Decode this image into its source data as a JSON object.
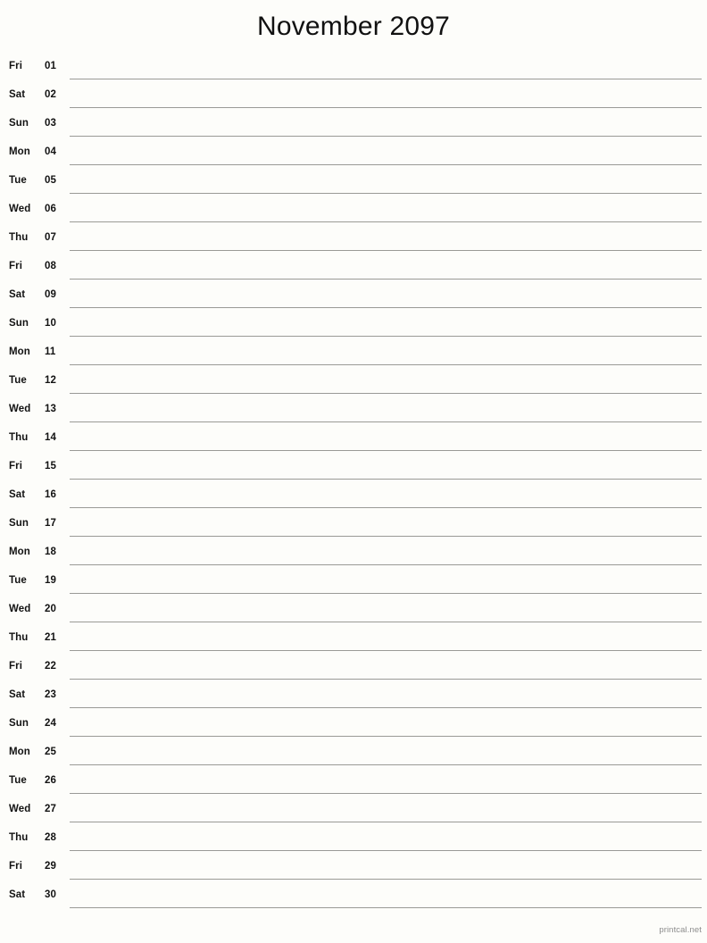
{
  "document": {
    "title": "November 2097",
    "month_name": "November",
    "year": "2097",
    "footer_credit": "printcal.net",
    "background_color": "#fdfdfa",
    "rule_color": "#9a9a96",
    "text_color": "#121212"
  },
  "days": [
    {
      "dow": "Fri",
      "num": "01"
    },
    {
      "dow": "Sat",
      "num": "02"
    },
    {
      "dow": "Sun",
      "num": "03"
    },
    {
      "dow": "Mon",
      "num": "04"
    },
    {
      "dow": "Tue",
      "num": "05"
    },
    {
      "dow": "Wed",
      "num": "06"
    },
    {
      "dow": "Thu",
      "num": "07"
    },
    {
      "dow": "Fri",
      "num": "08"
    },
    {
      "dow": "Sat",
      "num": "09"
    },
    {
      "dow": "Sun",
      "num": "10"
    },
    {
      "dow": "Mon",
      "num": "11"
    },
    {
      "dow": "Tue",
      "num": "12"
    },
    {
      "dow": "Wed",
      "num": "13"
    },
    {
      "dow": "Thu",
      "num": "14"
    },
    {
      "dow": "Fri",
      "num": "15"
    },
    {
      "dow": "Sat",
      "num": "16"
    },
    {
      "dow": "Sun",
      "num": "17"
    },
    {
      "dow": "Mon",
      "num": "18"
    },
    {
      "dow": "Tue",
      "num": "19"
    },
    {
      "dow": "Wed",
      "num": "20"
    },
    {
      "dow": "Thu",
      "num": "21"
    },
    {
      "dow": "Fri",
      "num": "22"
    },
    {
      "dow": "Sat",
      "num": "23"
    },
    {
      "dow": "Sun",
      "num": "24"
    },
    {
      "dow": "Mon",
      "num": "25"
    },
    {
      "dow": "Tue",
      "num": "26"
    },
    {
      "dow": "Wed",
      "num": "27"
    },
    {
      "dow": "Thu",
      "num": "28"
    },
    {
      "dow": "Fri",
      "num": "29"
    },
    {
      "dow": "Sat",
      "num": "30"
    }
  ]
}
